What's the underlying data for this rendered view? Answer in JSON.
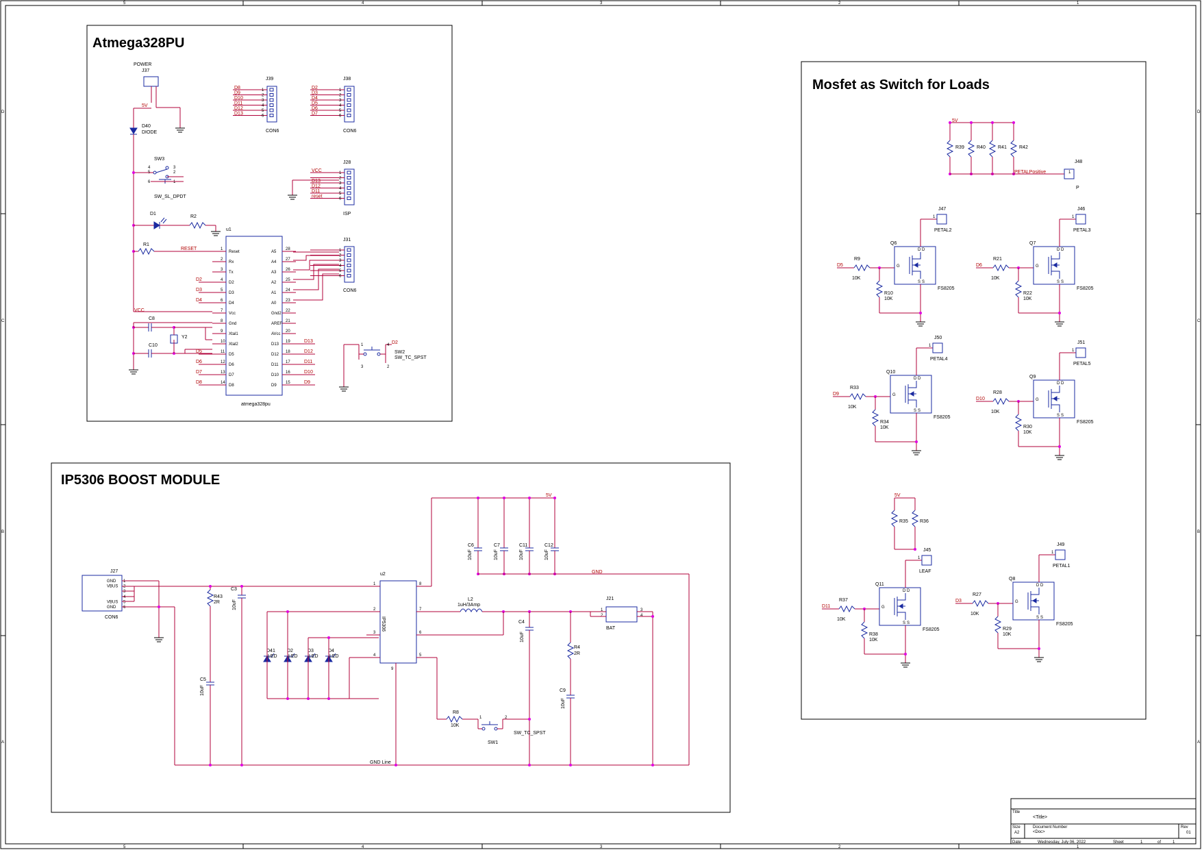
{
  "sections": {
    "atmega": {
      "title": "Atmega328PU"
    },
    "mosfet": {
      "title": "Mosfet as Switch for Loads"
    },
    "boost": {
      "title": "IP5306 BOOST MODULE"
    }
  },
  "title_block": {
    "title_label": "Title",
    "title_value": "<Title>",
    "size_label": "Size",
    "size_value": "A2",
    "docnum_label": "Document Number",
    "docnum_value": "<Doc>",
    "rev_label": "Rev",
    "rev_value": "01",
    "date_label": "Date",
    "date_value": "Wednesday, July 06, 2022",
    "sheet_label": "Sheet",
    "sheet_value": "1",
    "of_label": "of",
    "of_value": "1"
  },
  "border": {
    "cols": [
      "5",
      "4",
      "3",
      "2",
      "1"
    ],
    "rows": [
      "D",
      "C",
      "B",
      "A"
    ]
  },
  "atmega": {
    "j37": {
      "ref": "J37",
      "value": "POWER"
    },
    "net_5v": "5V",
    "d40": {
      "ref": "D40",
      "value": "DIODE"
    },
    "sw3": {
      "ref": "SW3",
      "value": "SW_SL_DPDT",
      "pins": [
        "4",
        "5",
        "6",
        "3",
        "2",
        "1"
      ]
    },
    "d1": "D1",
    "r2": "R2",
    "r1": "R1",
    "u1": "u1",
    "net_reset": "RESET",
    "net_vcc": "VCC",
    "c8": "C8",
    "c10": "C10",
    "y2": "Y2",
    "u1_value": "atmega328pu",
    "u1_left_pins": [
      {
        "num": "1",
        "name": "Reset",
        "net": ""
      },
      {
        "num": "2",
        "name": "Rx",
        "net": ""
      },
      {
        "num": "3",
        "name": "Tx",
        "net": ""
      },
      {
        "num": "4",
        "name": "D2",
        "net": "D2"
      },
      {
        "num": "5",
        "name": "D3",
        "net": "D3"
      },
      {
        "num": "6",
        "name": "D4",
        "net": "D4"
      },
      {
        "num": "7",
        "name": "Vcc",
        "net": ""
      },
      {
        "num": "8",
        "name": "Gnd",
        "net": ""
      },
      {
        "num": "9",
        "name": "Xtal1",
        "net": ""
      },
      {
        "num": "10",
        "name": "Xtal2",
        "net": ""
      },
      {
        "num": "11",
        "name": "D5",
        "net": "D5"
      },
      {
        "num": "12",
        "name": "D6",
        "net": "D6"
      },
      {
        "num": "13",
        "name": "D7",
        "net": "D7"
      },
      {
        "num": "14",
        "name": "D8",
        "net": "D8"
      }
    ],
    "u1_right_pins": [
      {
        "num": "28",
        "name": "A5",
        "net": ""
      },
      {
        "num": "27",
        "name": "A4",
        "net": ""
      },
      {
        "num": "26",
        "name": "A3",
        "net": ""
      },
      {
        "num": "25",
        "name": "A2",
        "net": ""
      },
      {
        "num": "24",
        "name": "A1",
        "net": ""
      },
      {
        "num": "23",
        "name": "A0",
        "net": ""
      },
      {
        "num": "22",
        "name": "Gnd2",
        "net": ""
      },
      {
        "num": "21",
        "name": "AREF",
        "net": ""
      },
      {
        "num": "20",
        "name": "AVcc",
        "net": ""
      },
      {
        "num": "19",
        "name": "D13",
        "net": "D13"
      },
      {
        "num": "18",
        "name": "D12",
        "net": "D12"
      },
      {
        "num": "17",
        "name": "D11",
        "net": "D11"
      },
      {
        "num": "16",
        "name": "D10",
        "net": "D10"
      },
      {
        "num": "15",
        "name": "D9",
        "net": "D9"
      }
    ],
    "j39": {
      "ref": "J39",
      "value": "CON6",
      "nets": [
        "D8",
        "D9",
        "D10",
        "D11",
        "D12",
        "D13"
      ]
    },
    "j38": {
      "ref": "J38",
      "value": "CON6",
      "nets": [
        "D2",
        "D3",
        "D4",
        "D5",
        "D6",
        "D7"
      ]
    },
    "j28": {
      "ref": "J28",
      "value": "ISP",
      "nets": [
        "VCC",
        "",
        "D13",
        "D12",
        "D11",
        "reset"
      ]
    },
    "j31": {
      "ref": "J31",
      "value": "CON6"
    },
    "sw2": {
      "ref": "SW2",
      "value": "SW_TC_SPST",
      "net": "D2",
      "pins": [
        "1",
        "4",
        "3",
        "2"
      ]
    },
    "connector_pins": [
      "1",
      "2",
      "3",
      "4",
      "5",
      "6"
    ]
  },
  "mosfet": {
    "net_5v": "5V",
    "pullups": [
      "R39",
      "R40",
      "R41",
      "R42"
    ],
    "net_petal_pos": "PETALPositive",
    "j48": {
      "ref": "J48",
      "value": "P",
      "pin": "1"
    },
    "channels": [
      {
        "q": "Q6",
        "j": "J47",
        "petal": "PETAL2",
        "rg": "R9",
        "rg_val": "10K",
        "net": "D5",
        "rp": "R10",
        "rp_val": "10K",
        "part": "FS8205"
      },
      {
        "q": "Q7",
        "j": "J46",
        "petal": "PETAL3",
        "rg": "R21",
        "rg_val": "10K",
        "net": "D6",
        "rp": "R22",
        "rp_val": "10K",
        "part": "FS8205"
      },
      {
        "q": "Q10",
        "j": "J50",
        "petal": "PETAL4",
        "rg": "R33",
        "rg_val": "10K",
        "net": "D9",
        "rp": "R34",
        "rp_val": "10K",
        "part": "FS8205"
      },
      {
        "q": "Q9",
        "j": "J51",
        "petal": "PETAL5",
        "rg": "R28",
        "rg_val": "10K",
        "net": "D10",
        "rp": "R30",
        "rp_val": "10K",
        "part": "FS8205"
      },
      {
        "q": "Q11",
        "j": "J45",
        "petal": "LEAF",
        "rg": "R37",
        "rg_val": "10K",
        "net": "D11",
        "rp": "R38",
        "rp_val": "10K",
        "part": "FS8205"
      },
      {
        "q": "Q8",
        "j": "J49",
        "petal": "PETAL1",
        "rg": "R27",
        "rg_val": "10K",
        "net": "D3",
        "rp": "R29",
        "rp_val": "10K",
        "part": "FS8205"
      }
    ],
    "leaf_net_5v": "5V",
    "leaf_r1": "R35",
    "leaf_r2": "R36",
    "mos_pins": {
      "d": "D",
      "s": "S",
      "g": "G"
    }
  },
  "boost": {
    "j27": {
      "ref": "J27",
      "value": "CON6",
      "pin_names": [
        "GND",
        "VBUS",
        "",
        "",
        "VBUS",
        "GND"
      ]
    },
    "r43": {
      "ref": "R43",
      "value": "2R"
    },
    "c3": {
      "ref": "C3",
      "value": "10uF"
    },
    "c5": {
      "ref": "C5",
      "value": "10uF"
    },
    "u2": {
      "ref": "u2",
      "value": "IP5306",
      "left_pins": [
        "1",
        "2",
        "3",
        "4"
      ],
      "right_pins": [
        "8",
        "7",
        "6",
        "5"
      ],
      "bottom_pin": "9"
    },
    "leds": [
      {
        "ref": "D41",
        "value": "LED"
      },
      {
        "ref": "D2",
        "value": "LED"
      },
      {
        "ref": "D3",
        "value": "LED"
      },
      {
        "ref": "D4",
        "value": "LED"
      }
    ],
    "caps_top": [
      {
        "ref": "C6",
        "value": "10uF"
      },
      {
        "ref": "C7",
        "value": "10uF"
      },
      {
        "ref": "C11",
        "value": "10uF"
      },
      {
        "ref": "C12",
        "value": "10uF"
      }
    ],
    "net_5v": "5V",
    "net_gnd": "GND",
    "l2": {
      "ref": "L2",
      "value": "1uH/3Amp"
    },
    "c4": {
      "ref": "C4",
      "value": "10uF"
    },
    "j21": {
      "ref": "J21",
      "value": "BAT",
      "pins": [
        "1",
        "2",
        "3",
        "4"
      ]
    },
    "r4": {
      "ref": "R4",
      "value": "2R"
    },
    "c9": {
      "ref": "C9",
      "value": "10uF"
    },
    "r8": {
      "ref": "R8",
      "value": "10K"
    },
    "sw1": {
      "ref": "SW1",
      "value": "SW_TC_SPST",
      "pins": [
        "1",
        "2"
      ]
    },
    "gnd_label": "GND Line"
  }
}
